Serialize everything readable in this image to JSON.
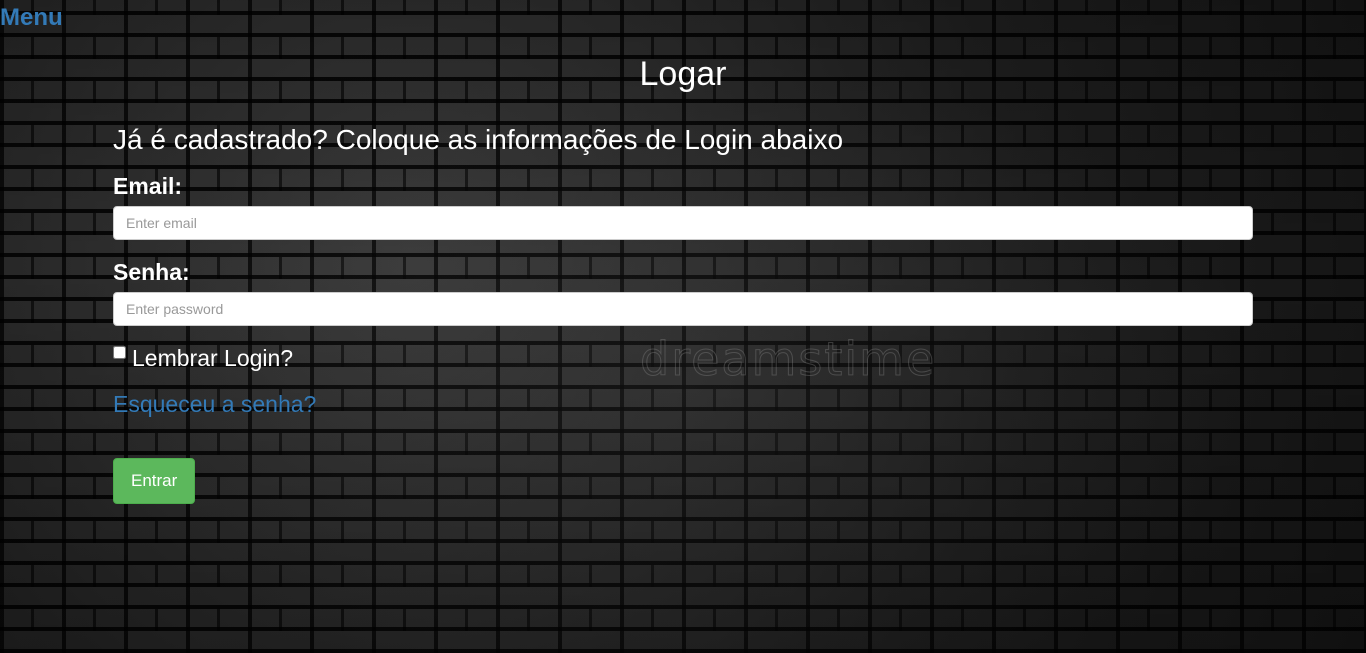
{
  "nav": {
    "menu_label": "Menu"
  },
  "page": {
    "title": "Logar",
    "subtitle": "Já é cadastrado? Coloque as informações de Login abaixo"
  },
  "form": {
    "email": {
      "label": "Email:",
      "placeholder": "Enter email",
      "value": ""
    },
    "password": {
      "label": "Senha:",
      "placeholder": "Enter password",
      "value": ""
    },
    "remember": {
      "label": "Lembrar Login?",
      "checked": false
    },
    "forgot_label": "Esqueceu a senha?",
    "submit_label": "Entrar"
  },
  "background": {
    "watermark_text": "dreamstime"
  },
  "colors": {
    "link": "#337ab7",
    "submit": "#5cb85c",
    "text": "#ffffff"
  }
}
